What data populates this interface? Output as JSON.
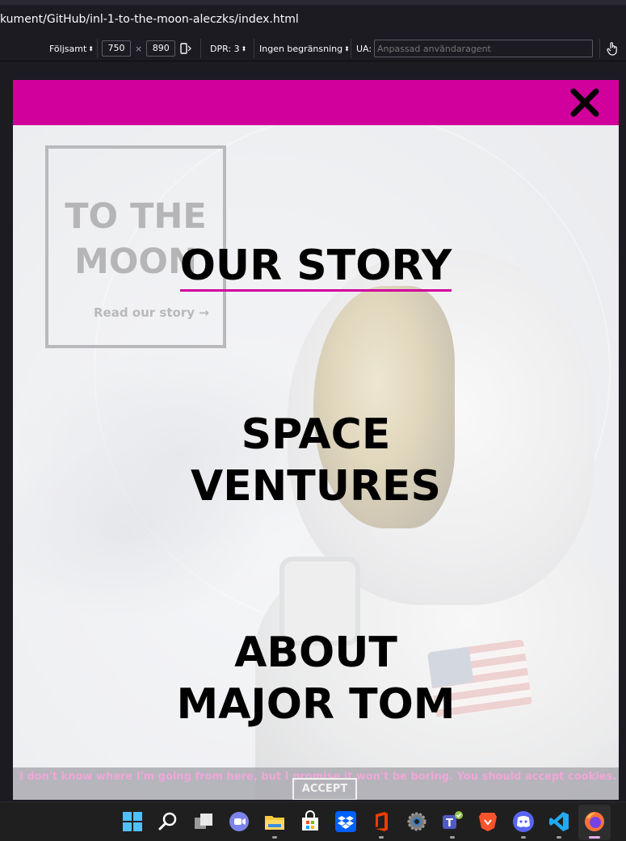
{
  "browser": {
    "url_path": "kument/GitHub/inl-1-to-the-moon-aleczks/index.html"
  },
  "responsive_toolbar": {
    "device_label": "Följsamt",
    "width": "750",
    "height": "890",
    "times": "×",
    "dpr_label": "DPR: 3",
    "throttle_label": "Ingen begränsning",
    "ua_label": "UA:",
    "ua_placeholder": "Anpassad användaragent"
  },
  "page": {
    "header_color": "#d1009c",
    "hero": {
      "title": "TO THE MOON",
      "link": "Read our story →"
    },
    "menu": {
      "items": [
        {
          "lines": [
            "OUR STORY"
          ]
        },
        {
          "lines": [
            "SPACE",
            "VENTURES"
          ]
        },
        {
          "lines": [
            "ABOUT",
            "MAJOR TOM"
          ]
        }
      ]
    },
    "cookie": {
      "text": "I don't know where I'm going from here, but I promise it won't be boring. You should accept cookies.",
      "button": "ACCEPT"
    }
  },
  "taskbar": {
    "icons": [
      "windows-start-icon",
      "search-icon",
      "task-view-icon",
      "teams-chat-icon",
      "file-explorer-icon",
      "microsoft-store-icon",
      "dropbox-icon",
      "office-icon",
      "settings-icon",
      "teams-icon",
      "brave-icon",
      "discord-icon",
      "vscode-icon",
      "firefox-icon"
    ]
  }
}
